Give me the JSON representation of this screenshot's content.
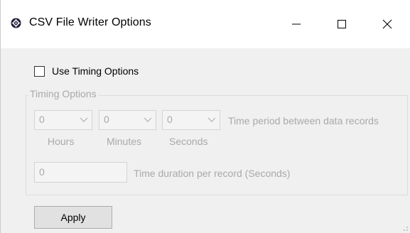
{
  "window": {
    "title": "CSV File Writer Options",
    "app_icon": "gear-icon",
    "controls": [
      "minimize-icon",
      "maximize-icon",
      "close-icon"
    ]
  },
  "use_timing": {
    "label": "Use Timing Options",
    "checked": false
  },
  "timing_group": {
    "legend": "Timing Options",
    "hours": {
      "value": "0",
      "label": "Hours"
    },
    "minutes": {
      "value": "0",
      "label": "Minutes"
    },
    "seconds": {
      "value": "0",
      "label": "Seconds"
    },
    "period_label": "Time period between data records",
    "duration": {
      "value": "0",
      "label": "Time duration per record (Seconds)"
    }
  },
  "actions": {
    "apply_label": "Apply"
  },
  "colors": {
    "disabled_text": "#a9a9a9",
    "titlebar_bg": "#ffffff",
    "dialog_bg": "#f0f0f0",
    "button_bg": "#e1e1e1"
  }
}
